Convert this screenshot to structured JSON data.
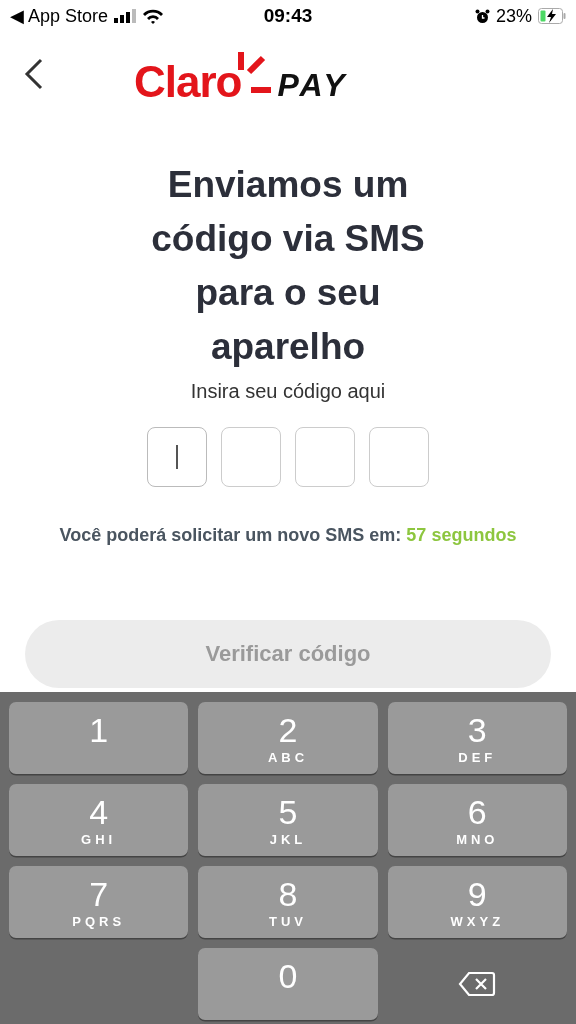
{
  "status_bar": {
    "back_label": "◀ App Store",
    "time": "09:43",
    "battery": "23%",
    "charging": true
  },
  "header": {
    "logo_left": "Claro",
    "logo_right": "PAY"
  },
  "title": "Enviamos um código via SMS para o seu aparelho",
  "subtitle": "Insira seu código aqui",
  "code_boxes": [
    {
      "focused": true
    },
    {
      "focused": false
    },
    {
      "focused": false
    },
    {
      "focused": false
    }
  ],
  "timer": {
    "text": "Você poderá solicitar um novo SMS em:",
    "countdown": "57 segundos"
  },
  "verify_button": {
    "label": "Verificar código",
    "disabled": true
  },
  "keypad": [
    {
      "kind": "digit",
      "digit": "1"
    },
    {
      "kind": "digit",
      "digit": "2",
      "letters": "ABC"
    },
    {
      "kind": "digit",
      "digit": "3",
      "letters": "DEF"
    },
    {
      "kind": "digit",
      "digit": "4",
      "letters": "GHI"
    },
    {
      "kind": "digit",
      "digit": "5",
      "letters": "JKL"
    },
    {
      "kind": "digit",
      "digit": "6",
      "letters": "MNO"
    },
    {
      "kind": "digit",
      "digit": "7",
      "letters": "PQRS"
    },
    {
      "kind": "digit",
      "digit": "8",
      "letters": "TUV"
    },
    {
      "kind": "digit",
      "digit": "9",
      "letters": "WXYZ"
    },
    {
      "kind": "blank"
    },
    {
      "kind": "digit",
      "digit": "0"
    },
    {
      "kind": "delete"
    }
  ]
}
